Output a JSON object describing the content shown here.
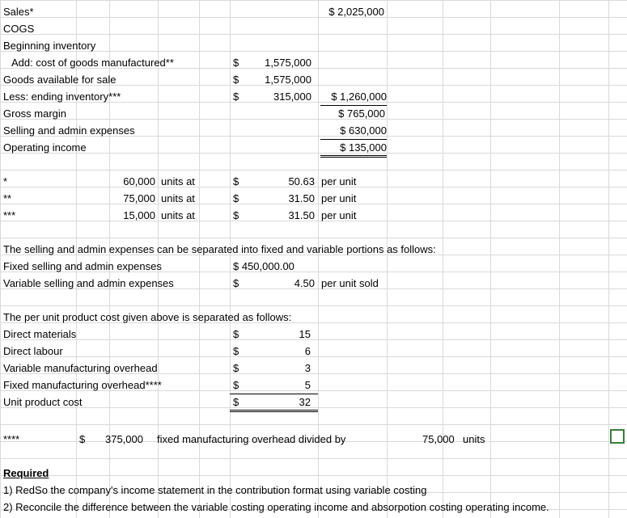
{
  "income_statement": {
    "sales_label": "Sales*",
    "sales_total": "$ 2,025,000",
    "cogs_label": "COGS",
    "beginning_inventory_label": "Beginning inventory",
    "cost_mfg_label": "Add: cost of goods manufactured**",
    "cost_mfg_dollar": "$",
    "cost_mfg_value": "1,575,000",
    "goods_available_label": "Goods available for sale",
    "goods_available_dollar": "$",
    "goods_available_value": "1,575,000",
    "ending_inventory_label": "Less: ending inventory***",
    "ending_inventory_dollar": "$",
    "ending_inventory_value": "315,000",
    "cogs_total": "$ 1,260,000",
    "gross_margin_label": "Gross margin",
    "gross_margin_total": "$ 765,000",
    "selling_admin_label": "Selling and admin expenses",
    "selling_admin_total": "$ 630,000",
    "operating_income_label": "Operating income",
    "operating_income_total": "$ 135,000"
  },
  "notes": [
    {
      "marker": "*",
      "units": "60,000",
      "units_at": "units at",
      "dollar": "$",
      "price": "50.63",
      "per": "per unit"
    },
    {
      "marker": "**",
      "units": "75,000",
      "units_at": "units at",
      "dollar": "$",
      "price": "31.50",
      "per": "per unit"
    },
    {
      "marker": "***",
      "units": "15,000",
      "units_at": "units at",
      "dollar": "$",
      "price": "31.50",
      "per": "per unit"
    }
  ],
  "sa_section": {
    "intro": "The selling and admin expenses can be separated into fixed and variable portions as follows:",
    "fixed_label": "Fixed selling and admin expenses",
    "fixed_value": "$ 450,000.00",
    "variable_label": "Variable selling and admin expenses",
    "variable_dollar": "$",
    "variable_value": "4.50",
    "variable_unit": "per unit sold"
  },
  "product_cost": {
    "intro": "The per unit product cost given above is separated as follows:",
    "rows": [
      {
        "label": "Direct materials",
        "dollar": "$",
        "value": "15"
      },
      {
        "label": "Direct labour",
        "dollar": "$",
        "value": "6"
      },
      {
        "label": "Variable manufacturing overhead",
        "dollar": "$",
        "value": "3"
      },
      {
        "label": "Fixed manufacturing overhead****",
        "dollar": "$",
        "value": "5"
      },
      {
        "label": "Unit product cost",
        "dollar": "$",
        "value": "32"
      }
    ]
  },
  "footnote4": {
    "marker": "****",
    "dollar": "$",
    "amount": "375,000",
    "text": "fixed manufacturing overhead divided by",
    "units": "75,000",
    "units_label": "units"
  },
  "required": {
    "heading": "Required",
    "line1": "1) RedSo the company's income statement in the contribution format using variable costing",
    "line2": "2) Reconcile the difference between the variable costing operating income and absorpotion costing operating income."
  }
}
